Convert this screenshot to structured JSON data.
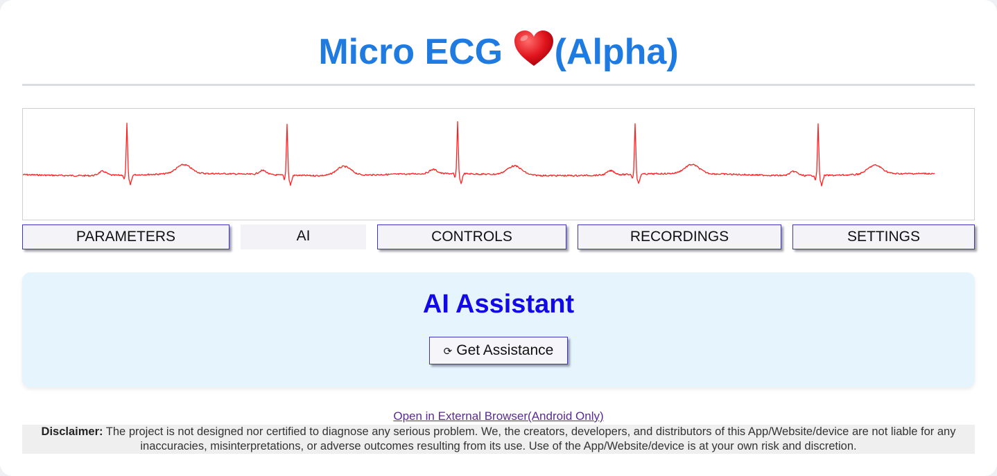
{
  "header": {
    "title_prefix": "Micro ECG ",
    "title_suffix": "(Alpha)",
    "heart_icon": "heart-icon",
    "title_color": "#1f7be0"
  },
  "ecg": {
    "trace_color": "#ff2020"
  },
  "tabs": [
    {
      "label": "PARAMETERS"
    },
    {
      "label": "AI",
      "active": true
    },
    {
      "label": "CONTROLS"
    },
    {
      "label": "RECORDINGS"
    },
    {
      "label": "SETTINGS"
    }
  ],
  "ai_panel": {
    "title": "AI Assistant",
    "button_icon": "refresh-icon",
    "button_label": "Get Assistance",
    "background": "#e6f4fd",
    "title_color": "#1209e6"
  },
  "footer": {
    "external_link": "Open in External Browser(Android Only)",
    "disclaimer_label": "Disclaimer:",
    "disclaimer_text": " The project is not designed nor certified to diagnose any serious problem. We, the creators, developers, and distributors of this App/Website/device are not liable for any inaccuracies, misinterpretations, or adverse outcomes resulting from its use. Use of the App/Website/device is at your own risk and discretion."
  }
}
